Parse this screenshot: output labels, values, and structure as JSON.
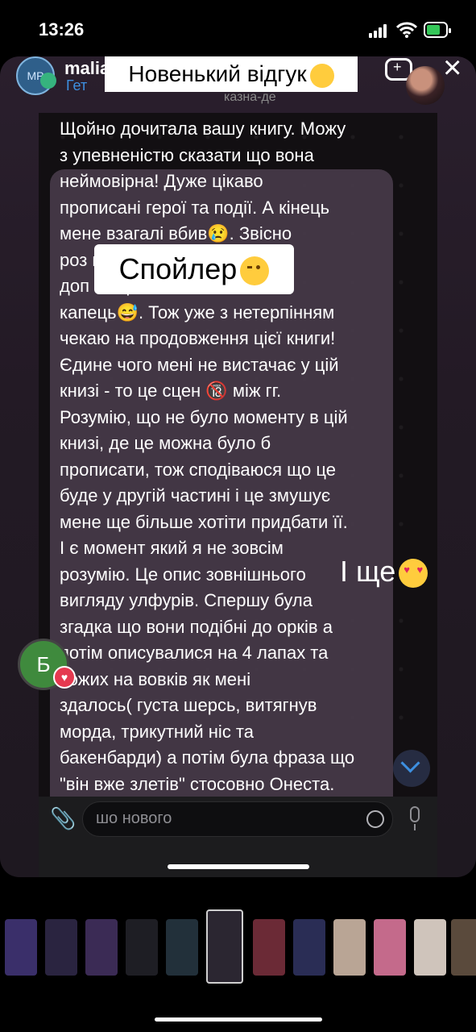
{
  "status_bar": {
    "time": "13:26"
  },
  "chat": {
    "name": "maliadpierce",
    "subtitle": "Гет",
    "status_caption": "казна-де",
    "avatar_text": "MP"
  },
  "story_title": "Новенький відгук",
  "message": {
    "text": "Щойно дочитала вашу книгу. Можу\nз упевненістю сказати що вона\nнеймовірна! Дуже цікаво\nпрописані герої та події. А кінець\nмене взагалі вбив😢. Звісно\nроз                                 щоб\nдоп                                 но це\nкапець😅.  Тож уже з нетерпінням\nчекаю на продовження цієї книги!\nЄдине чого мені не вистачає у цій\nкнизі - то це сцен 🔞 між гг.\nРозумію, що не було моменту в цій\nкнизі, де це можна було б\nпрописати, тож сподіваюся що це\nбуде у другій частині і це змушує\nмене ще більше хотіти придбати її.\nІ є момент який я не зовсім\nрозумію. Це опис зовнішнього\nвигляду улфурів. Спершу була\nзгадка що вони подібні до орків а\n потім описувалися на 4 лапах та\n  хожих на вовків як мені\nздалось( густа шерсь, витягнув\nморда, трикутний ніс та\nбакенбарди) а потім була фраза що\n\"він вже злетів\" стосовно Онеста."
  },
  "stickers": {
    "spoiler": "Спойлер",
    "i_sche": "І ще"
  },
  "reaction_avatar": {
    "letter": "Б"
  },
  "composer": {
    "placeholder": "шо нового"
  },
  "thumbnails": [
    {
      "color": "#3a2f6a"
    },
    {
      "color": "#2a2440"
    },
    {
      "color": "#3b2b55"
    },
    {
      "color": "#1e1e24"
    },
    {
      "color": "#22303a"
    },
    {
      "color": "#2b2631",
      "selected": true
    },
    {
      "color": "#6b2a36"
    },
    {
      "color": "#2a2d55"
    },
    {
      "color": "#b9a595"
    },
    {
      "color": "#c46a8b"
    },
    {
      "color": "#cfc4bb"
    },
    {
      "color": "#5a4a3c"
    }
  ]
}
